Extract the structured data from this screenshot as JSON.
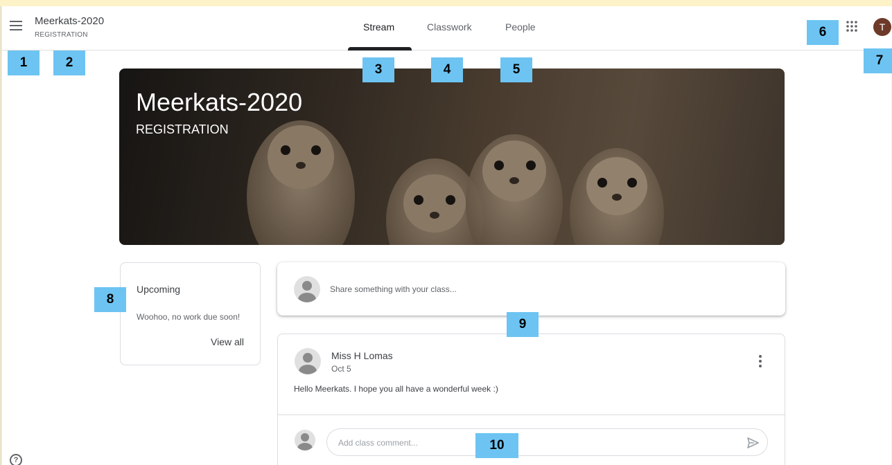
{
  "header": {
    "class_name": "Meerkats-2020",
    "class_section": "REGISTRATION",
    "tabs": [
      {
        "label": "Stream",
        "active": true
      },
      {
        "label": "Classwork",
        "active": false
      },
      {
        "label": "People",
        "active": false
      }
    ],
    "avatar_initial": "T"
  },
  "banner": {
    "title": "Meerkats-2020",
    "subtitle": "REGISTRATION"
  },
  "upcoming": {
    "title": "Upcoming",
    "message": "Woohoo, no work due soon!",
    "view_all": "View all"
  },
  "share": {
    "placeholder": "Share something with your class..."
  },
  "post": {
    "author": "Miss H Lomas",
    "date": "Oct 5",
    "body": "Hello Meerkats.  I hope you all have a wonderful week :)",
    "comment_placeholder": "Add class comment..."
  },
  "callouts": [
    "1",
    "2",
    "3",
    "4",
    "5",
    "6",
    "7",
    "8",
    "9",
    "10"
  ],
  "colors": {
    "callout": "#6dc4f2",
    "page_border": "#fdf2c8",
    "avatar": "#6d3a2a"
  },
  "icons": [
    "hamburger-menu-icon",
    "apps-grid-icon",
    "more-vertical-icon",
    "send-icon",
    "help-icon"
  ]
}
